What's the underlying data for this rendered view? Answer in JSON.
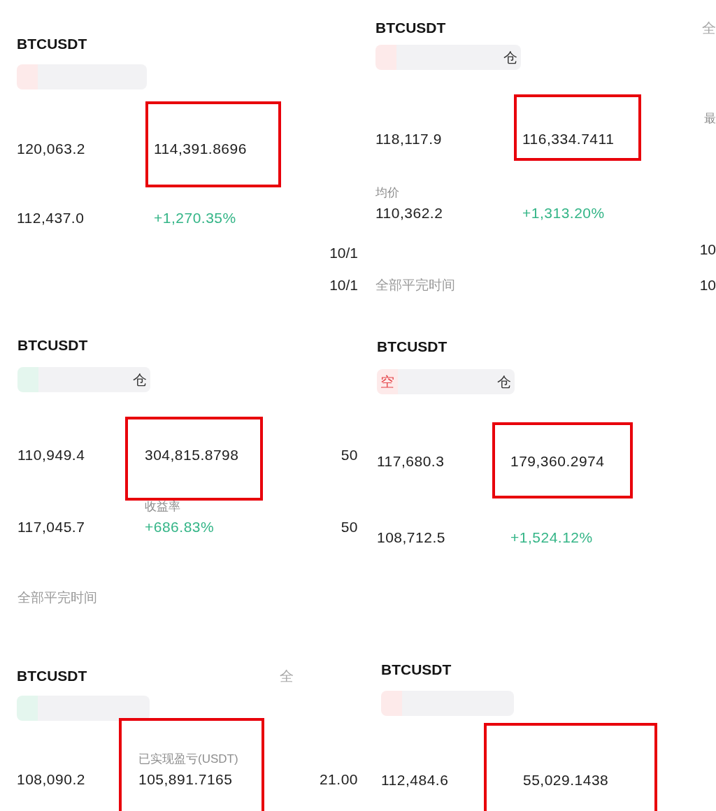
{
  "panels": [
    {
      "symbol": "BTCUSDT",
      "tag": {
        "kind": "short"
      },
      "metric_rows": [
        {
          "column_1": {
            "value": "120,063.2",
            "kind": "amount",
            "highlighted": false
          },
          "column_2": {
            "value": "114,391.8696",
            "kind": "amount",
            "highlighted": true
          }
        },
        {
          "column_1": {
            "value": "112,437.0",
            "kind": "amount",
            "highlighted": false
          },
          "column_2": {
            "value": "+1,270.35%",
            "kind": "gain",
            "highlighted": false
          }
        }
      ],
      "time_rows": [
        {
          "value": "10/1"
        },
        {
          "value": "10/1"
        }
      ]
    },
    {
      "symbol": "BTCUSDT",
      "tag": {
        "kind": "long",
        "mode_label": "仓"
      },
      "metric_rows": [
        {
          "column_1": {
            "value": "110,949.4",
            "kind": "amount",
            "highlighted": false
          },
          "column_2": {
            "value": "304,815.8798",
            "kind": "amount",
            "highlighted": true
          },
          "column_3": {
            "value": "50",
            "kind": "amount",
            "highlighted": false
          }
        },
        {
          "column_1": {
            "value": "117,045.7",
            "kind": "amount",
            "highlighted": false
          },
          "column_2": {
            "label": "收益率",
            "value": "+686.83%",
            "kind": "gain",
            "highlighted": false
          },
          "column_3": {
            "value": "50",
            "kind": "amount",
            "highlighted": false
          }
        }
      ],
      "time_rows": [
        {
          "label": "全部平完时间"
        }
      ]
    },
    {
      "symbol": "BTCUSDT",
      "header_right": "全",
      "tag": {
        "kind": "long"
      },
      "metric_rows": [
        {
          "column_1": {
            "value": "108,090.2",
            "kind": "amount",
            "highlighted": false
          },
          "column_2": {
            "label": "已实现盈亏(USDT)",
            "value": "105,891.7165",
            "kind": "amount",
            "highlighted": true
          },
          "column_3": {
            "value": "21.00",
            "kind": "amount",
            "highlighted": false
          }
        }
      ]
    },
    {
      "symbol": "BTCUSDT",
      "header_right": "全",
      "tag": {
        "kind": "short",
        "mode_label": "仓"
      },
      "metric_rows": [
        {
          "column_1": {
            "value": "118,117.9",
            "kind": "amount",
            "highlighted": false
          },
          "column_2": {
            "value": "116,334.7411",
            "kind": "amount",
            "highlighted": true
          },
          "column_3": {
            "label": "最",
            "highlighted": false
          }
        },
        {
          "column_1": {
            "label": "均价",
            "value": "110,362.2",
            "kind": "amount",
            "highlighted": false
          },
          "column_2": {
            "value": "+1,313.20%",
            "kind": "gain",
            "highlighted": false
          }
        }
      ],
      "time_rows": [
        {
          "value": "10"
        },
        {
          "label": "全部平完时间",
          "value": "10"
        }
      ]
    },
    {
      "symbol": "BTCUSDT",
      "tag": {
        "kind": "short",
        "side_label": "空",
        "mode_label": "仓"
      },
      "metric_rows": [
        {
          "column_1": {
            "value": "117,680.3",
            "kind": "amount",
            "highlighted": false
          },
          "column_2": {
            "value": "179,360.2974",
            "kind": "amount",
            "highlighted": true
          }
        },
        {
          "column_1": {
            "value": "108,712.5",
            "kind": "amount",
            "highlighted": false
          },
          "column_2": {
            "value": "+1,524.12%",
            "kind": "gain",
            "highlighted": false
          }
        }
      ]
    },
    {
      "symbol": "BTCUSDT",
      "tag": {
        "kind": "short"
      },
      "metric_rows": [
        {
          "column_1": {
            "value": "112,484.6",
            "kind": "amount",
            "highlighted": false
          },
          "column_2": {
            "value": "55,029.1438",
            "kind": "amount",
            "highlighted": true
          }
        }
      ]
    }
  ]
}
